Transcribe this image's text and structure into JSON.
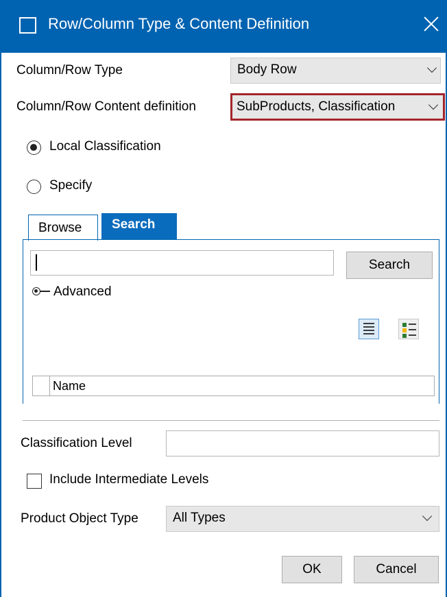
{
  "window": {
    "title": "Row/Column Type & Content Definition"
  },
  "fields": {
    "type_label": "Column/Row Type",
    "type_value": "Body Row",
    "content_label": "Column/Row Content definition",
    "content_value": "SubProducts, Classification"
  },
  "radios": {
    "local": {
      "label": "Local Classification",
      "checked": true
    },
    "specify": {
      "label": "Specify",
      "checked": false
    }
  },
  "tabs": {
    "browse": "Browse",
    "search": "Search",
    "active": "Search"
  },
  "search": {
    "input_value": "",
    "button_label": "Search",
    "advanced_label": "Advanced"
  },
  "grid": {
    "columns": [
      "Name"
    ]
  },
  "classification_level": {
    "label": "Classification Level",
    "value": ""
  },
  "include_intermediate": {
    "label": "Include Intermediate Levels",
    "checked": false
  },
  "product_object_type": {
    "label": "Product Object Type",
    "value": "All Types"
  },
  "buttons": {
    "ok": "OK",
    "cancel": "Cancel"
  },
  "colors": {
    "titlebar": "#0063b1",
    "active_tab": "#0a6cbd",
    "highlight_border": "#a4262c"
  },
  "icons": {
    "title": "window-icon",
    "close": "close-icon",
    "advanced": "expand-key-icon",
    "list_view": "list-view-icon",
    "detail_view": "detail-view-icon"
  }
}
